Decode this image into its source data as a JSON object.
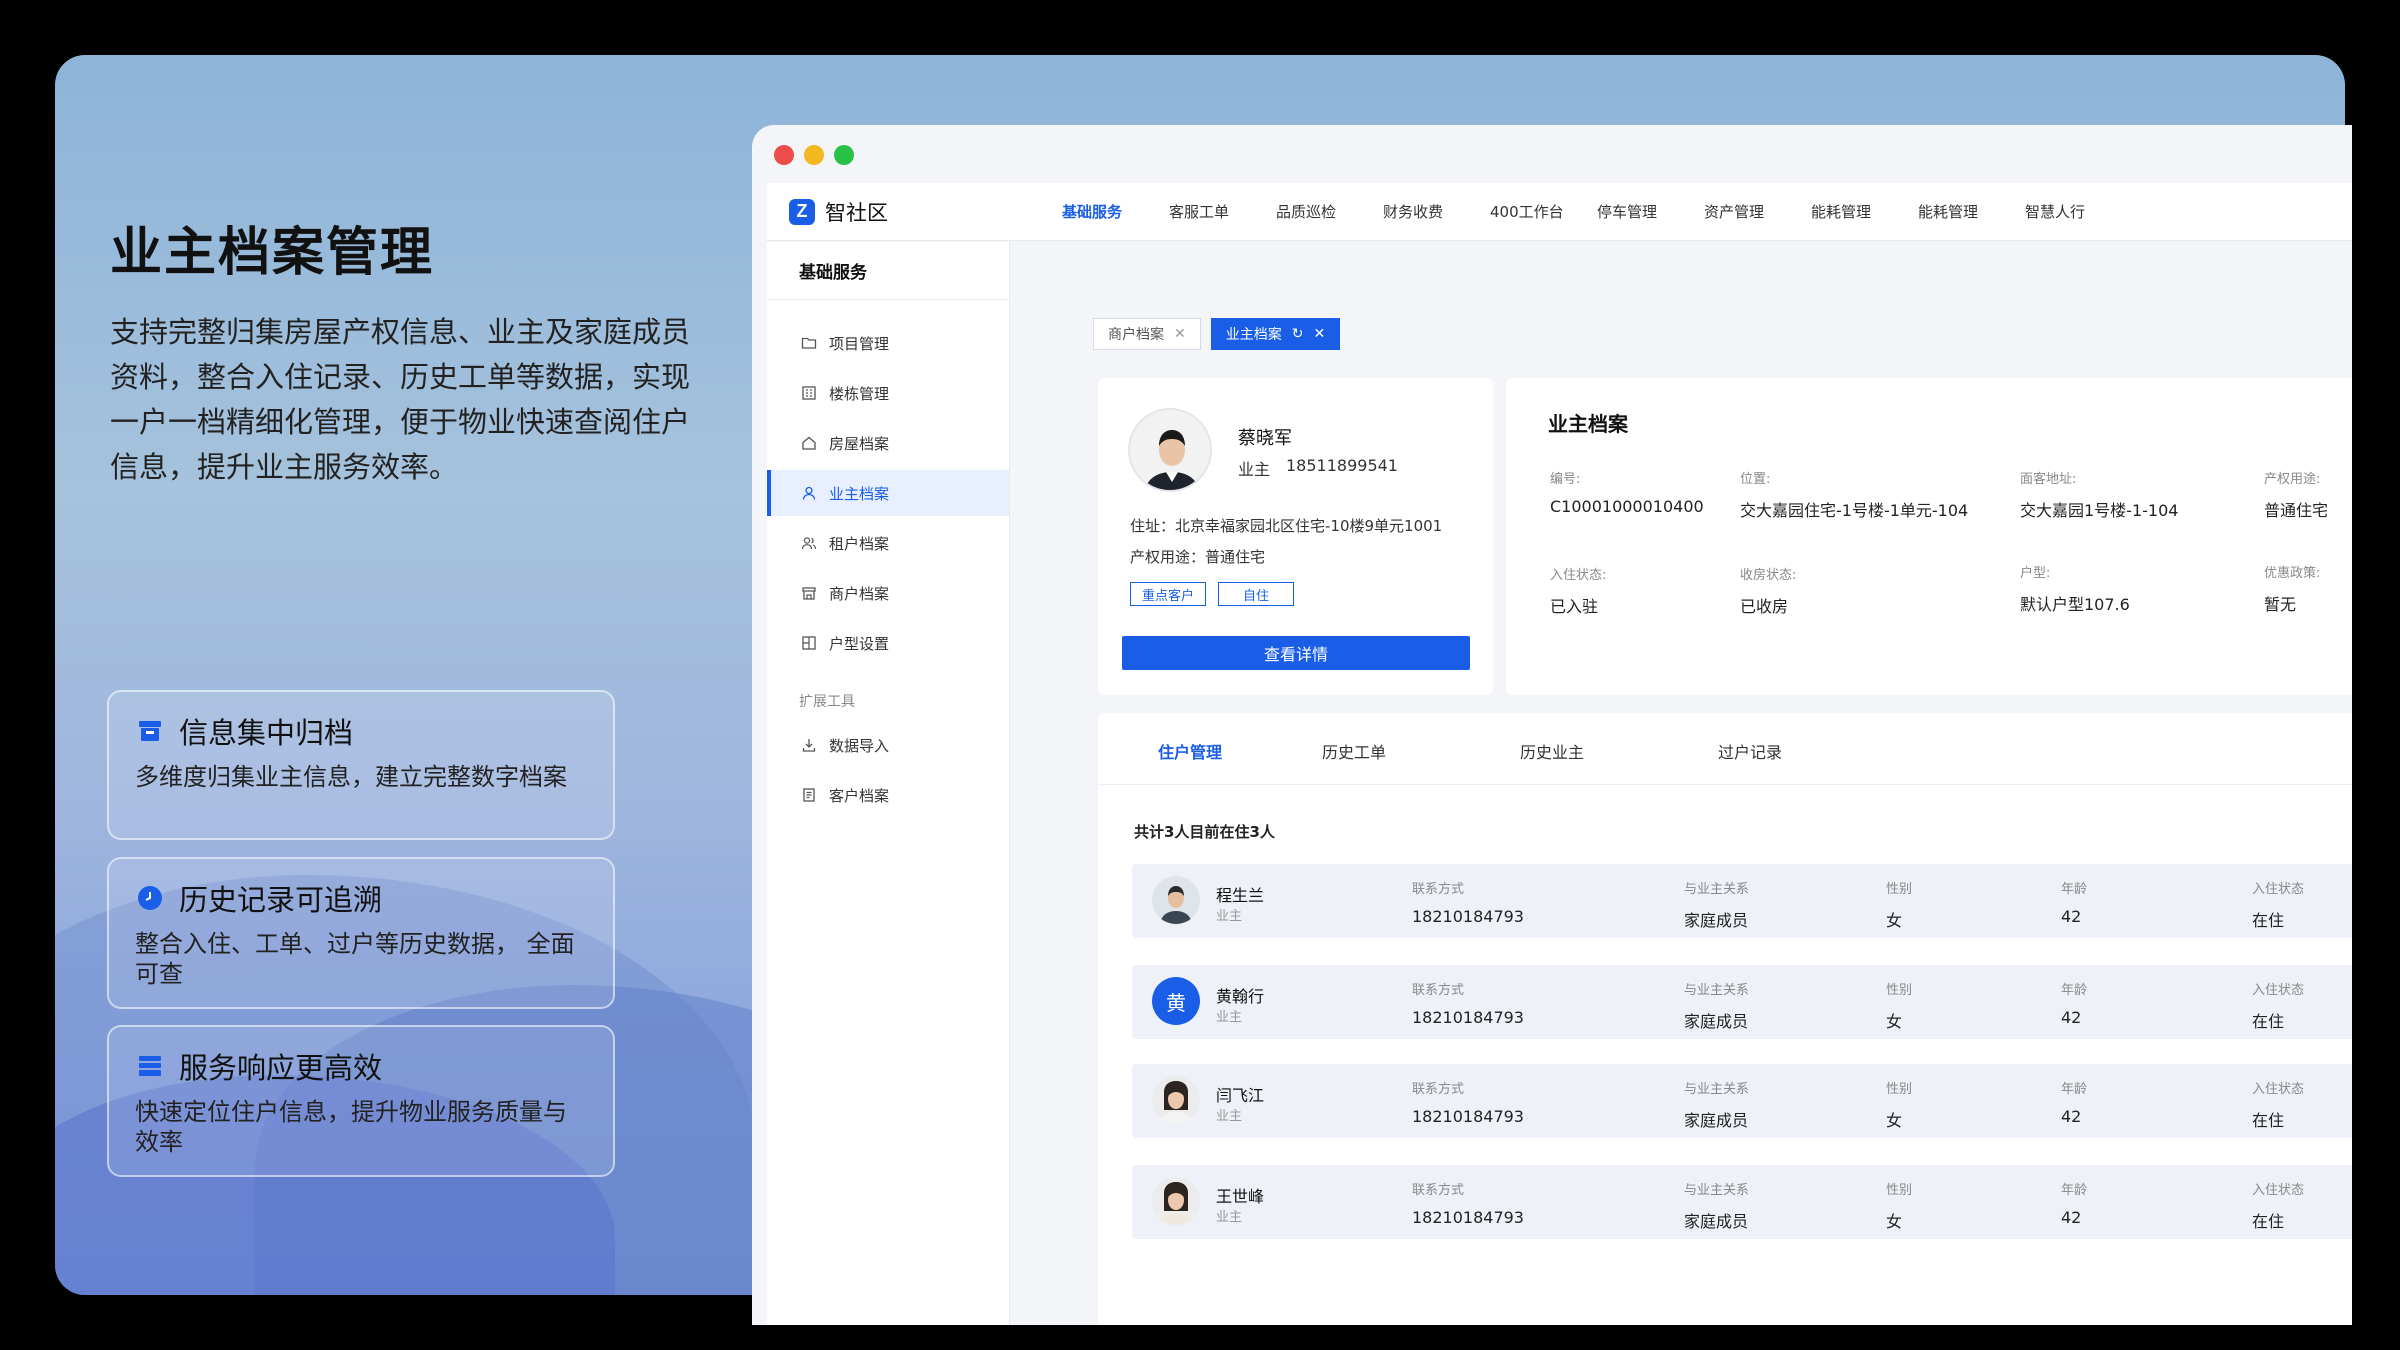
{
  "hero": {
    "title": "业主档案管理",
    "description": "支持完整归集房屋产权信息、业主及家庭成员资料，整合入住记录、历史工单等数据，实现一户一档精细化管理，便于物业快速查阅住户信息，提升业主服务效率。"
  },
  "features": [
    {
      "title": "信息集中归档",
      "text": "多维度归集业主信息，建立完整数字档案",
      "icon": "archive-icon"
    },
    {
      "title": "历史记录可追溯",
      "text": "整合入住、工单、过户等历史数据， 全面可查",
      "icon": "clock-icon"
    },
    {
      "title": "服务响应更高效",
      "text": "快速定位住户信息，提升物业服务质量与效率",
      "icon": "stack-icon"
    }
  ],
  "app": {
    "logo_mark": "Z",
    "name": "智社区",
    "nav": [
      "基础服务",
      "客服工单",
      "品质巡检",
      "财务收费",
      "400工作台",
      "停车管理",
      "资产管理",
      "能耗管理",
      "能耗管理",
      "智慧人行"
    ],
    "nav_active": 0
  },
  "sidebar": {
    "title": "基础服务",
    "items": [
      {
        "label": "项目管理",
        "icon": "folder-icon"
      },
      {
        "label": "楼栋管理",
        "icon": "building-icon"
      },
      {
        "label": "房屋档案",
        "icon": "home-icon"
      },
      {
        "label": "业主档案",
        "icon": "user-icon",
        "active": true
      },
      {
        "label": "租户档案",
        "icon": "users-icon"
      },
      {
        "label": "商户档案",
        "icon": "store-icon"
      },
      {
        "label": "户型设置",
        "icon": "layout-icon"
      }
    ],
    "group": "扩展工具",
    "tools": [
      {
        "label": "数据导入",
        "icon": "import-icon"
      },
      {
        "label": "客户档案",
        "icon": "file-icon"
      }
    ]
  },
  "tabs": [
    {
      "label": "商户档案",
      "active": false
    },
    {
      "label": "业主档案",
      "active": true
    }
  ],
  "profile": {
    "name": "蔡晓军",
    "role": "业主",
    "phone": "18511899541",
    "address": "住址：北京幸福家园北区住宅-10楼9单元1001",
    "usage": "产权用途：普通住宅",
    "tags": [
      "重点客户",
      "自住"
    ],
    "button": "查看详情"
  },
  "archive": {
    "title": "业主档案",
    "fields": [
      {
        "label": "编号:",
        "value": "C10001000010400"
      },
      {
        "label": "位置:",
        "value": "交大嘉园住宅-1号楼-1单元-104"
      },
      {
        "label": "面客地址:",
        "value": "交大嘉园1号楼-1-104"
      },
      {
        "label": "产权用途:",
        "value": "普通住宅"
      },
      {
        "label": "入住状态:",
        "value": "已入驻"
      },
      {
        "label": "收房状态:",
        "value": "已收房"
      },
      {
        "label": "户型:",
        "value": "默认户型107.6"
      },
      {
        "label": "优惠政策:",
        "value": "暂无"
      }
    ]
  },
  "residents": {
    "tabs": [
      "住户管理",
      "历史工单",
      "历史业主",
      "过户记录"
    ],
    "summary": "共计3人目前在住3人",
    "col_labels": {
      "contact": "联系方式",
      "relation": "与业主关系",
      "gender": "性别",
      "age": "年龄",
      "status": "入住状态"
    },
    "rows": [
      {
        "name": "程生兰",
        "role": "业主",
        "contact": "18210184793",
        "relation": "家庭成员",
        "gender": "女",
        "age": "42",
        "status": "在住",
        "avatar": "photo-male"
      },
      {
        "name": "黄翰行",
        "role": "业主",
        "contact": "18210184793",
        "relation": "家庭成员",
        "gender": "女",
        "age": "42",
        "status": "在住",
        "avatar": "letter",
        "letter": "黄"
      },
      {
        "name": "闫飞江",
        "role": "业主",
        "contact": "18210184793",
        "relation": "家庭成员",
        "gender": "女",
        "age": "42",
        "status": "在住",
        "avatar": "photo-female"
      },
      {
        "name": "王世峰",
        "role": "业主",
        "contact": "18210184793",
        "relation": "家庭成员",
        "gender": "女",
        "age": "42",
        "status": "在住",
        "avatar": "photo-female"
      }
    ]
  },
  "colors": {
    "accent": "#1a5ee8",
    "dot_red": "#ee4b4b",
    "dot_yellow": "#f3b820",
    "dot_green": "#27c245"
  }
}
